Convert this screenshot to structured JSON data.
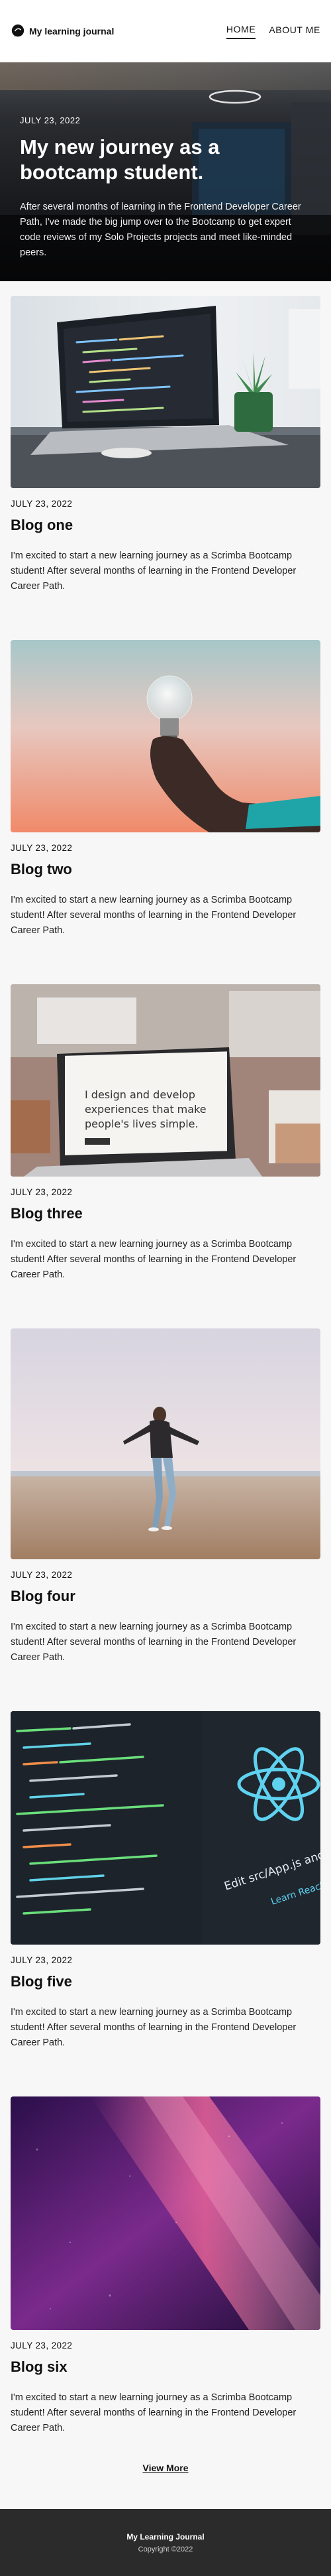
{
  "header": {
    "logo_text": "My learning journal",
    "nav": [
      {
        "label": "HOME",
        "active": true
      },
      {
        "label": "ABOUT ME",
        "active": false
      }
    ]
  },
  "hero": {
    "date": "JULY 23, 2022",
    "title": "My new journey as a bootcamp student.",
    "excerpt": "After several months of learning in the Frontend Developer Career Path, I've made the big jump over to the Bootcamp to get expert code reviews of my Solo Projects projects and meet like-minded peers."
  },
  "posts": [
    {
      "date": "JULY 23, 2022",
      "title": "Blog one",
      "excerpt": "I'm excited to start a new learning journey as a Scrimba Bootcamp student! After several months of learning in the Frontend Developer Career Path."
    },
    {
      "date": "JULY 23, 2022",
      "title": "Blog two",
      "excerpt": "I'm excited to start a new learning journey as a Scrimba Bootcamp student! After several months of learning in the Frontend Developer Career Path."
    },
    {
      "date": "JULY 23, 2022",
      "title": "Blog three",
      "excerpt": "I'm excited to start a new learning journey as a Scrimba Bootcamp student! After several months of learning in the Frontend Developer Career Path.",
      "image_text": [
        "I design and develop",
        "experiences that make",
        "people's lives simple."
      ]
    },
    {
      "date": "JULY 23, 2022",
      "title": "Blog four",
      "excerpt": "I'm excited to start a new learning journey as a Scrimba Bootcamp student! After several months of learning in the Frontend Developer Career Path."
    },
    {
      "date": "JULY 23, 2022",
      "title": "Blog five",
      "excerpt": "I'm excited to start a new learning journey as a Scrimba Bootcamp student! After several months of learning in the Frontend Developer Career Path.",
      "image_text": [
        "Edit src/App.js and save",
        "Learn React"
      ]
    },
    {
      "date": "JULY 23, 2022",
      "title": "Blog six",
      "excerpt": "I'm excited to start a new learning journey as a Scrimba Bootcamp student! After several months of learning in the Frontend Developer Career Path."
    }
  ],
  "view_more_label": "View More",
  "footer": {
    "title": "My Learning Journal",
    "copyright": "Copyright ©2022"
  }
}
